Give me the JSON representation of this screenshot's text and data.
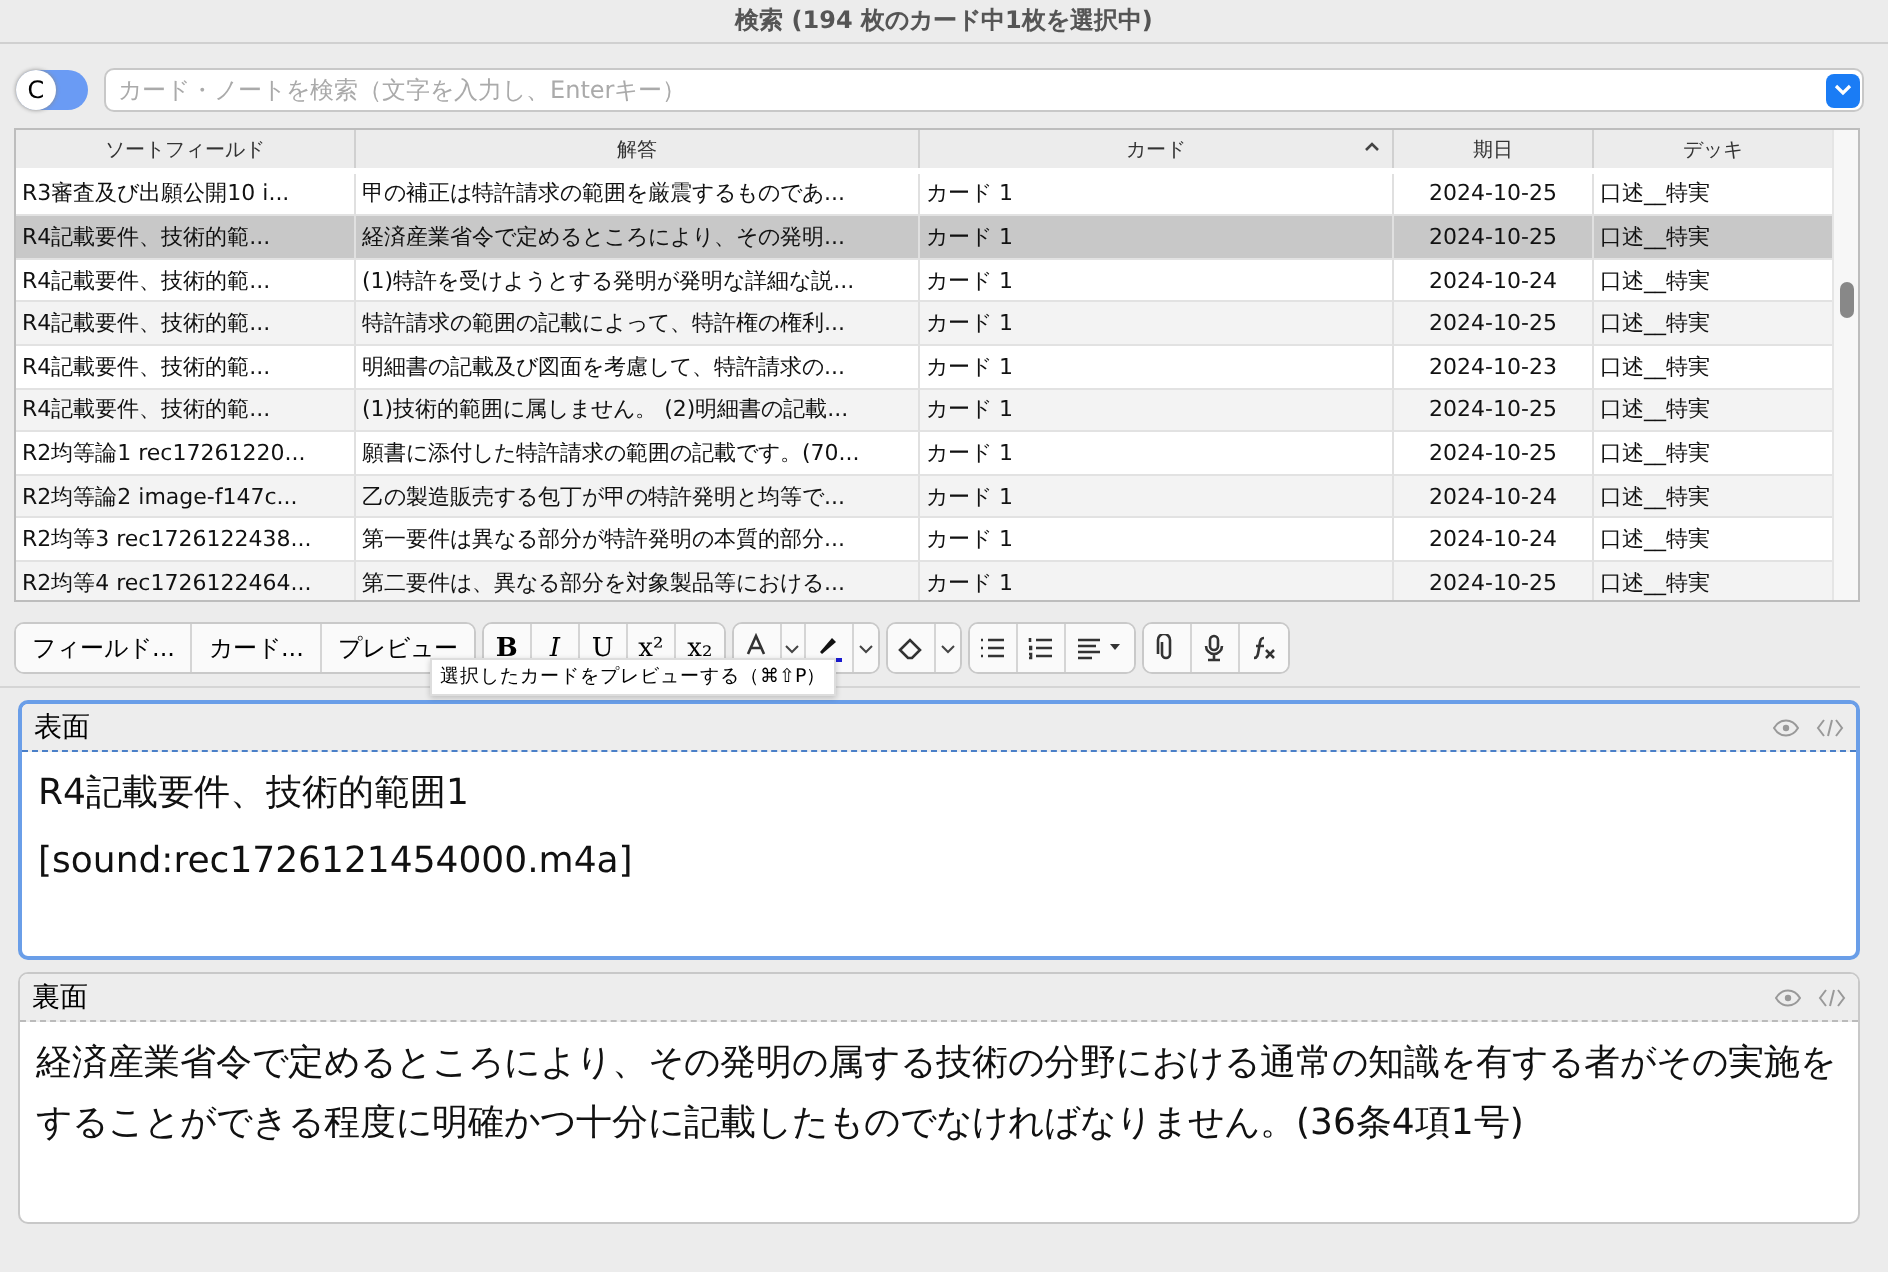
{
  "window": {
    "title": "検索 (194 枚のカード中1枚を選択中)"
  },
  "search": {
    "toggle_label": "C",
    "placeholder": "カード・ノートを検索（文字を入力し、Enterキー）"
  },
  "table": {
    "columns": [
      {
        "label": "ソートフィールド",
        "sorted": false
      },
      {
        "label": "解答",
        "sorted": false
      },
      {
        "label": "カード",
        "sorted": true
      },
      {
        "label": "期日",
        "sorted": false
      },
      {
        "label": "デッキ",
        "sorted": false
      }
    ],
    "rows": [
      {
        "cells": [
          "R3審査及び出願公開10 i...",
          "甲の補正は特許請求の範囲を厳震するものであ...",
          "カード 1",
          "2024-10-25",
          "口述__特実"
        ],
        "selected": false
      },
      {
        "cells": [
          "R4記載要件、技術的範...",
          "経済産業省令で定めるところにより、その発明...",
          "カード 1",
          "2024-10-25",
          "口述__特実"
        ],
        "selected": true
      },
      {
        "cells": [
          "R4記載要件、技術的範...",
          "(1)特許を受けようとする発明が発明な詳細な説...",
          "カード 1",
          "2024-10-24",
          "口述__特実"
        ],
        "selected": false
      },
      {
        "cells": [
          "R4記載要件、技術的範...",
          "特許請求の範囲の記載によって、特許権の権利...",
          "カード 1",
          "2024-10-25",
          "口述__特実"
        ],
        "selected": false
      },
      {
        "cells": [
          "R4記載要件、技術的範...",
          "明細書の記載及び図面を考慮して、特許請求の...",
          "カード 1",
          "2024-10-23",
          "口述__特実"
        ],
        "selected": false
      },
      {
        "cells": [
          "R4記載要件、技術的範...",
          "(1)技術的範囲に属しません。 (2)明細書の記載...",
          "カード 1",
          "2024-10-25",
          "口述__特実"
        ],
        "selected": false
      },
      {
        "cells": [
          "R2均等論1 rec17261220...",
          "願書に添付した特許請求の範囲の記載です。(70...",
          "カード 1",
          "2024-10-25",
          "口述__特実"
        ],
        "selected": false
      },
      {
        "cells": [
          "R2均等論2  image-f147c...",
          "乙の製造販売する包丁が甲の特許発明と均等で...",
          "カード 1",
          "2024-10-24",
          "口述__特実"
        ],
        "selected": false
      },
      {
        "cells": [
          "R2均等3 rec1726122438...",
          "第一要件は異なる部分が特許発明の本質的部分...",
          "カード 1",
          "2024-10-24",
          "口述__特実"
        ],
        "selected": false
      },
      {
        "cells": [
          "R2均等4 rec1726122464...",
          "第二要件は、異なる部分を対象製品等における...",
          "カード 1",
          "2024-10-25",
          "口述__特実"
        ],
        "selected": false
      }
    ]
  },
  "toolbar": {
    "buttons": [
      "フィールド...",
      "カード...",
      "プレビュー"
    ],
    "format": [
      "B",
      "I",
      "U",
      "x²",
      "x₂"
    ],
    "tooltip": "選択したカードをプレビューする（⌘⇧P）"
  },
  "fields": [
    {
      "label": "表面",
      "focused": true,
      "lines": [
        "R4記載要件、技術的範囲1",
        "[sound:rec1726121454000.m4a]"
      ]
    },
    {
      "label": "裏面",
      "focused": false,
      "lines": [
        "経済産業省令で定めるところにより、その発明の属する技術の分野における通常の知識を有する者がその実施をすることができる程度に明確かつ十分に記載したものでなければなりません。(36条4項1号)"
      ]
    }
  ]
}
